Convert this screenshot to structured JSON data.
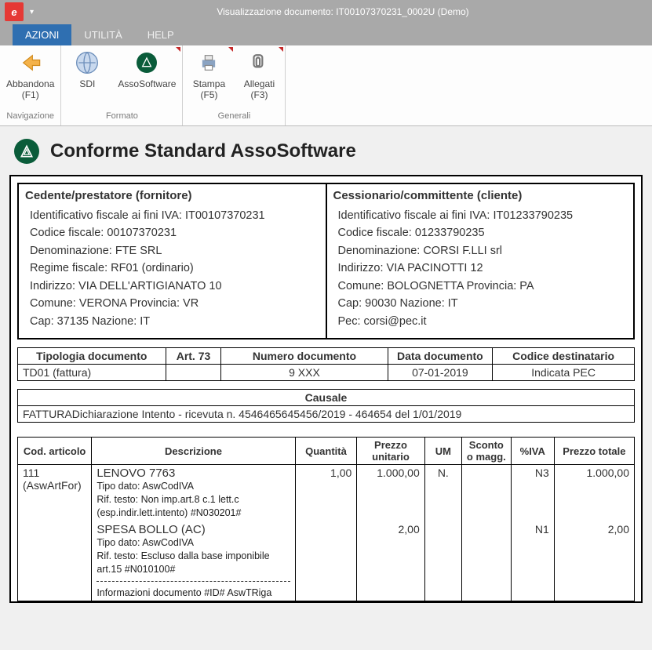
{
  "window": {
    "title": "Visualizzazione documento: IT00107370231_0002U  (Demo)"
  },
  "tabs": {
    "azioni": "AZIONI",
    "utilita": "UTILITÀ",
    "help": "HELP"
  },
  "ribbon": {
    "abbandona_l1": "Abbandona",
    "abbandona_l2": "(F1)",
    "sdi": "SDI",
    "assosoftware": "AssoSoftware",
    "stampa_l1": "Stampa",
    "stampa_l2": "(F5)",
    "allegati_l1": "Allegati",
    "allegati_l2": "(F3)",
    "group_nav": "Navigazione",
    "group_formato": "Formato",
    "group_generali": "Generali"
  },
  "header": {
    "title": "Conforme Standard AssoSoftware"
  },
  "fornitore": {
    "title": "Cedente/prestatore (fornitore)",
    "iva": "Identificativo fiscale ai fini IVA: IT00107370231",
    "cf": "Codice fiscale: 00107370231",
    "den": "Denominazione: FTE SRL",
    "regime": "Regime fiscale: RF01 (ordinario)",
    "ind": "Indirizzo: VIA DELL'ARTIGIANATO 10",
    "com": "Comune: VERONA Provincia: VR",
    "cap": "Cap: 37135 Nazione: IT"
  },
  "cliente": {
    "title": "Cessionario/committente (cliente)",
    "iva": "Identificativo fiscale ai fini IVA: IT01233790235",
    "cf": "Codice fiscale: 01233790235",
    "den": "Denominazione: CORSI F.LLI srl",
    "ind": "Indirizzo: VIA PACINOTTI 12",
    "com": "Comune: BOLOGNETTA Provincia: PA",
    "cap": "Cap: 90030 Nazione: IT",
    "pec": "Pec: corsi@pec.it"
  },
  "meta": {
    "h_tipo": "Tipologia documento",
    "h_art73": "Art. 73",
    "h_num": "Numero documento",
    "h_data": "Data documento",
    "h_dest": "Codice destinatario",
    "tipo": "TD01 (fattura)",
    "art73": "",
    "num": "9 XXX",
    "data": "07-01-2019",
    "dest": "Indicata PEC"
  },
  "causale": {
    "h": "Causale",
    "val": "FATTURADichiarazione Intento - ricevuta n. 4546465645456/2019 - 464654 del 1/01/2019"
  },
  "lines": {
    "h_cod": "Cod. articolo",
    "h_desc": "Descrizione",
    "h_qta": "Quantità",
    "h_pu": "Prezzo unitario",
    "h_um": "UM",
    "h_sconto": "Sconto o magg.",
    "h_iva": "%IVA",
    "h_tot": "Prezzo totale",
    "r1": {
      "cod1": "111",
      "cod2": "(AswArtFor)",
      "desc": "LENOVO 7763",
      "sub1": "Tipo dato: AswCodIVA",
      "sub2": "Rif. testo: Non imp.art.8 c.1 lett.c (esp.indir.lett.intento) #N030201#",
      "qta": "1,00",
      "pu": "1.000,00",
      "um": "N.",
      "iva": "N3",
      "tot": "1.000,00"
    },
    "r2": {
      "desc": "SPESA BOLLO (AC)",
      "sub1": "Tipo dato: AswCodIVA",
      "sub2": "Rif. testo: Escluso dalla base imponibile art.15 #N010100#",
      "pu": "2,00",
      "iva": "N1",
      "tot": "2,00"
    },
    "r3": {
      "desc": "Informazioni documento #ID# AswTRiga"
    }
  }
}
